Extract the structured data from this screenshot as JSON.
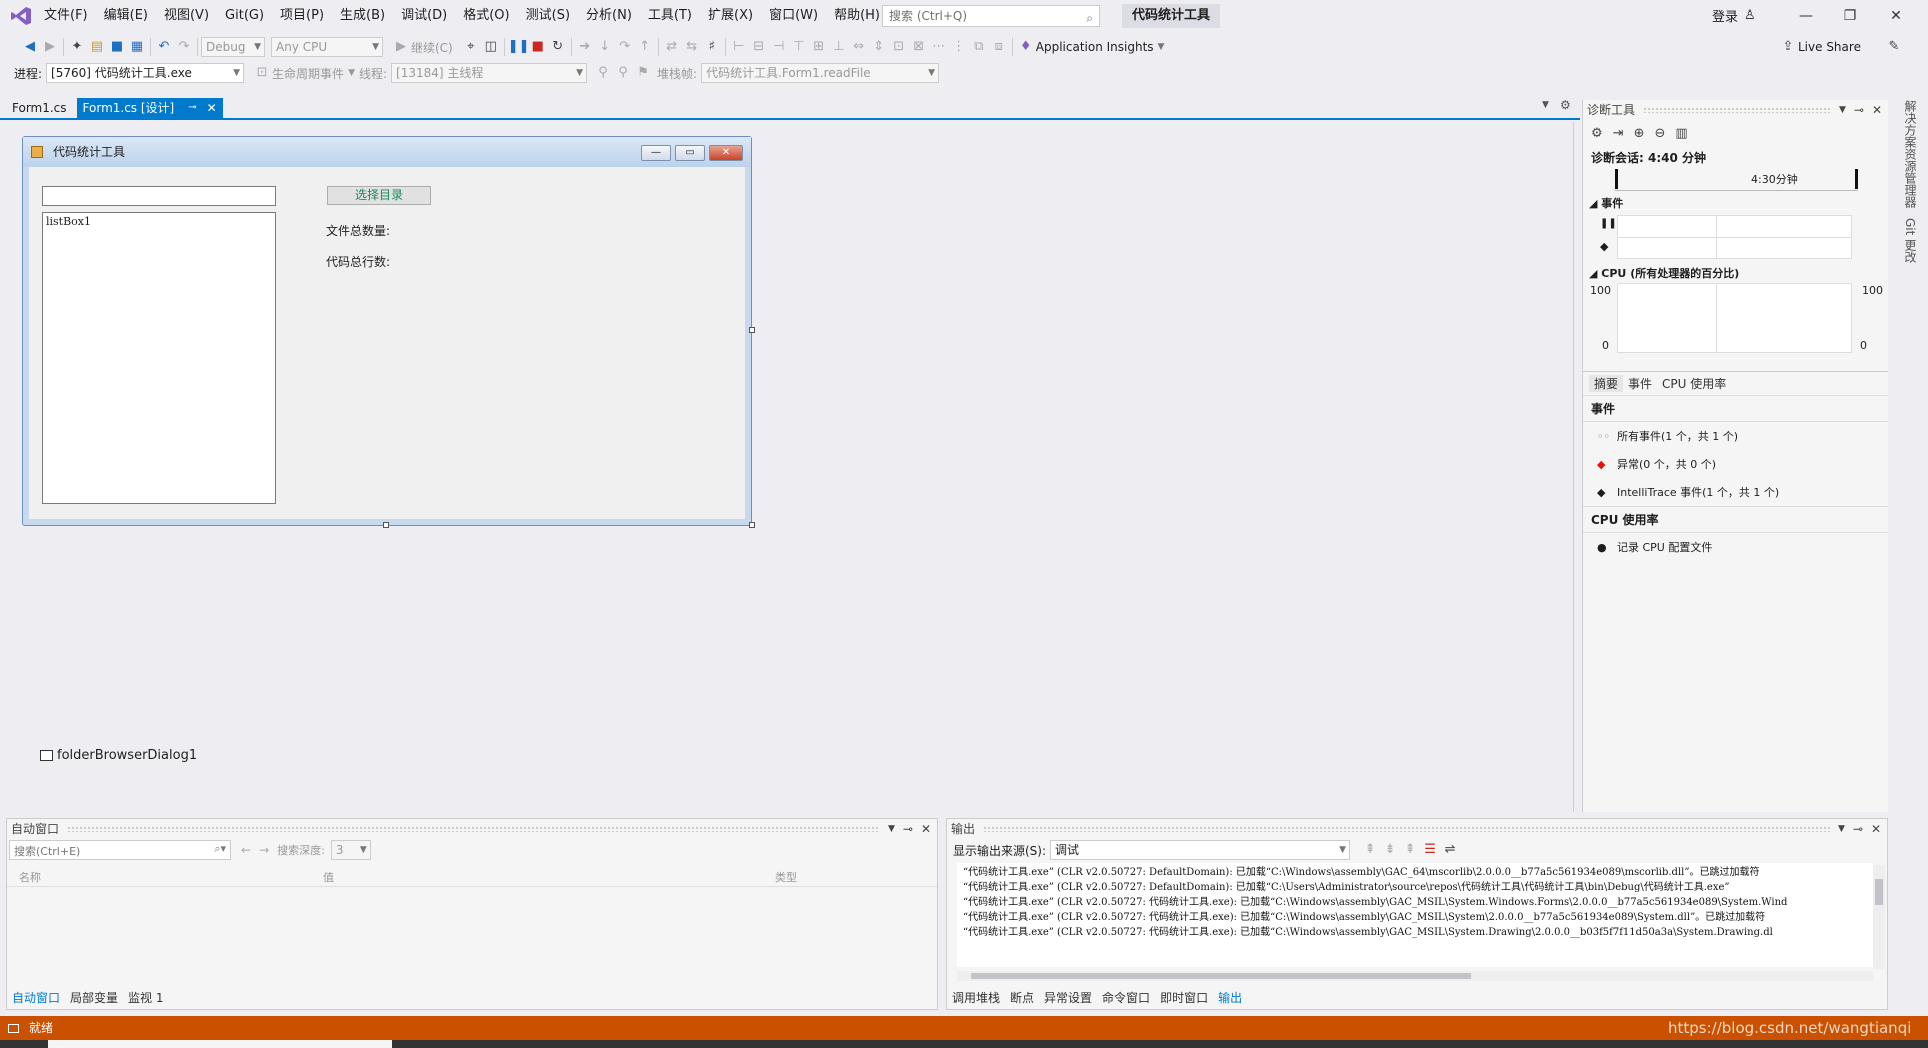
{
  "menubar": {
    "items": [
      "文件(F)",
      "编辑(E)",
      "视图(V)",
      "Git(G)",
      "项目(P)",
      "生成(B)",
      "调试(D)",
      "格式(O)",
      "测试(S)",
      "分析(N)",
      "工具(T)",
      "扩展(X)",
      "窗口(W)",
      "帮助(H)"
    ],
    "search_placeholder": "搜索 (Ctrl+Q)",
    "project_title": "代码统计工具",
    "signin": "登录"
  },
  "toolbar1": {
    "config": "Debug",
    "platform": "Any CPU",
    "continue": "继续(C)",
    "app_insights": "Application Insights",
    "live_share": "Live Share"
  },
  "toolbar2": {
    "process_label": "进程:",
    "process_value": "[5760] 代码统计工具.exe",
    "lifecycle": "生命周期事件",
    "thread_label": "线程:",
    "thread_value": "[13184] 主线程",
    "stack_label": "堆栈帧:",
    "stack_value": "代码统计工具.Form1.readFile"
  },
  "doc_tabs": [
    "Form1.cs",
    "Form1.cs [设计]"
  ],
  "form": {
    "title": "代码统计工具",
    "listbox_text": "listBox1",
    "button_label": "选择目录",
    "label_file_count": "文件总数量:",
    "label_line_count": "代码总行数:",
    "tray_component": "folderBrowserDialog1"
  },
  "diagnostics": {
    "title": "诊断工具",
    "session": "诊断会话: 4:40 分钟",
    "timeline_tick": "4:30分钟",
    "events_header": "事件",
    "cpu_header": "CPU (所有处理器的百分比)",
    "cpu_max": "100",
    "cpu_min": "0",
    "tabs": [
      "摘要",
      "事件",
      "CPU 使用率"
    ],
    "section_events": "事件",
    "event_items": [
      "所有事件(1 个，共 1 个)",
      "异常(0 个，共 0 个)",
      "IntelliTrace 事件(1 个，共 1 个)"
    ],
    "section_cpu": "CPU 使用率",
    "cpu_item": "记录 CPU 配置文件"
  },
  "sidebar": {
    "items": [
      "解决方案资源管理器",
      "Git 更改"
    ]
  },
  "autos": {
    "title": "自动窗口",
    "search_placeholder": "搜索(Ctrl+E)",
    "depth_label": "搜索深度:",
    "depth_value": "3",
    "columns": [
      "名称",
      "值",
      "类型"
    ],
    "tabs": [
      "自动窗口",
      "局部变量",
      "监视 1"
    ]
  },
  "output": {
    "title": "输出",
    "source_label": "显示输出来源(S):",
    "source_value": "调试",
    "lines": [
      "“代码统计工具.exe” (CLR v2.0.50727: DefaultDomain): 已加载“C:\\Windows\\assembly\\GAC_64\\mscorlib\\2.0.0.0__b77a5c561934e089\\mscorlib.dll”。已跳过加载符",
      "“代码统计工具.exe” (CLR v2.0.50727: DefaultDomain): 已加载“C:\\Users\\Administrator\\source\\repos\\代码统计工具\\代码统计工具\\bin\\Debug\\代码统计工具.exe”",
      "“代码统计工具.exe” (CLR v2.0.50727: 代码统计工具.exe): 已加载“C:\\Windows\\assembly\\GAC_MSIL\\System.Windows.Forms\\2.0.0.0__b77a5c561934e089\\System.Wind",
      "“代码统计工具.exe” (CLR v2.0.50727: 代码统计工具.exe): 已加载“C:\\Windows\\assembly\\GAC_MSIL\\System\\2.0.0.0__b77a5c561934e089\\System.dll”。已跳过加载符",
      "“代码统计工具.exe” (CLR v2.0.50727: 代码统计工具.exe): 已加载“C:\\Windows\\assembly\\GAC_MSIL\\System.Drawing\\2.0.0.0__b03f5f7f11d50a3a\\System.Drawing.dl"
    ],
    "tabs": [
      "调用堆栈",
      "断点",
      "异常设置",
      "命令窗口",
      "即时窗口",
      "输出"
    ]
  },
  "status": {
    "text": "就绪",
    "watermark": "https://blog.csdn.net/wangtianqi"
  },
  "colors": {
    "accent": "#007acc",
    "status_bar": "#ca5100",
    "exception": "#e51400"
  }
}
